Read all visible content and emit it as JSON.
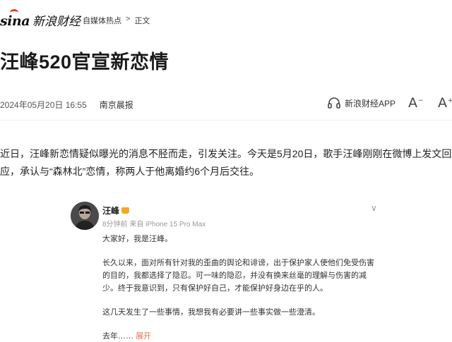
{
  "header": {
    "logo_text": "sina",
    "logo_cn": "新浪财经",
    "breadcrumb": {
      "section": "自媒体热点",
      "separator": ">",
      "current": "正文"
    }
  },
  "article": {
    "title": "汪峰520官宣新恋情",
    "datetime": "2024年05月20日 16:55",
    "source": "南京晨报",
    "app_label": "新浪财经APP",
    "font_decrease_label": "A",
    "font_increase_label": "A",
    "paragraph": "近日，汪峰新恋情疑似曝光的消息不胫而走，引发关注。今天是5月20日，歌手汪峰刚刚在微博上发文回应，承认与“森林北”恋情，称两人于他离婚约6个月后交往。"
  },
  "weibo": {
    "username": "汪峰",
    "meta": "8分钟前 来自 iPhone 15 Pro Max",
    "more": "∨",
    "greeting": "大家好，我是汪峰。",
    "p1": "长久以来，面对所有针对我的歪曲的舆论和诽谤，出于保护家人使他们免受伤害的目的，我都选择了隐忍。可一味的隐忍，并没有换来丝毫的理解与伤害的减少。终于我意识到，只有保护好自己，才能保护好身边在乎的人。",
    "p2": "这几天发生了一些事情，我想我有必要讲一些事实做一些澄清。",
    "p3_start": "去年……",
    "expand": "展开"
  },
  "colors": {
    "accent_red": "#e8312f",
    "weibo_orange": "#eb7350",
    "crown": "#f5a623"
  },
  "icons": [
    "headphone-icon",
    "font-decrease-icon",
    "font-increase-icon",
    "verified-crown-icon"
  ]
}
